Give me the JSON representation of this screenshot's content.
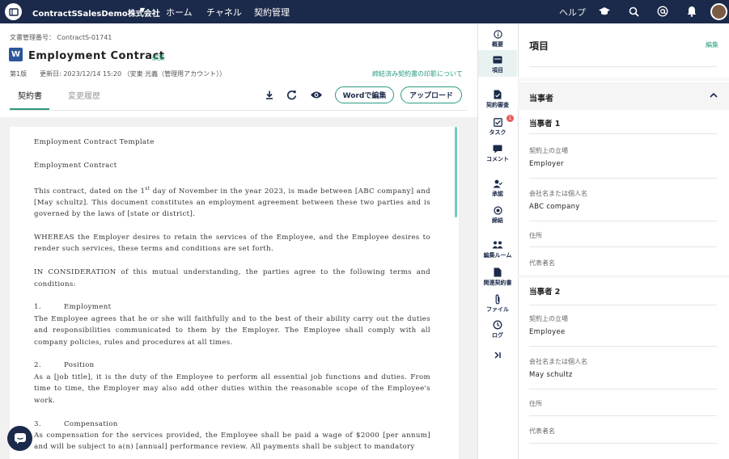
{
  "topbar": {
    "company": "ContractSSalesDemo株式会社",
    "nav": [
      "ホーム",
      "チャネル",
      "契約管理"
    ],
    "help": "ヘルプ",
    "icons": [
      "graduation-cap-icon",
      "search-icon",
      "at-icon",
      "bell-icon"
    ]
  },
  "document": {
    "number_label": "文書管理番号： ContractS-01741",
    "title": "Employment Contract",
    "edit_label": "編集",
    "version_line": "第1版　　更新日: 2023/12/14 15:20 （安東 光義（管理用アカウント））",
    "print_link": "締結済み契約書の印影について"
  },
  "tabs": [
    "契約書",
    "変更履歴"
  ],
  "actions": {
    "edit_in_word": "Wordで編集",
    "upload": "アップロード"
  },
  "contract": {
    "p1": "Employment Contract Template",
    "p2": "Employment Contract",
    "p3_pre": "This contract, dated on the 1",
    "p3_sup": "st",
    "p3_post": " day of November in the year 2023, is made between [ABC company] and [May schultz]. This document constitutes an employment agreement between these two parties and is governed by the laws of [state or district].",
    "p4": "WHEREAS the Employer desires to retain the services of the Employee, and the Employee desires to render such services, these terms and conditions are set forth.",
    "p5": "IN CONSIDERATION of this mutual understanding, the parties agree to the following terms and conditions:",
    "s1_num": "1.",
    "s1_head": "Employment",
    "s1_body": "The Employee agrees that he or she will faithfully and to the best of their ability carry out the duties and responsibilities communicated to them by the Employer. The Employee shall comply with all company policies, rules and procedures at all times.",
    "s2_num": "2.",
    "s2_head": "Position",
    "s2_body": "As a [job title], it is the duty of the Employee to perform all essential job functions and duties. From time to time, the Employer may also add other duties within the reasonable scope of the Employee's work.",
    "s3_num": "3.",
    "s3_head": "Compensation",
    "s3_body": "As compensation for the services provided, the Employee shall be paid a wage of $2000 [per annum] and will be subject to a(n) [annual] performance review. All payments shall be subject to mandatory"
  },
  "rail": {
    "items": [
      {
        "label": "概要",
        "icon": "info-icon"
      },
      {
        "label": "項目",
        "icon": "items-icon"
      },
      {
        "label": "契約審査",
        "icon": "review-icon"
      },
      {
        "label": "タスク",
        "icon": "task-icon"
      },
      {
        "label": "コメント",
        "icon": "comment-icon"
      },
      {
        "label": "承認",
        "icon": "approval-icon"
      },
      {
        "label": "締結",
        "icon": "seal-icon"
      },
      {
        "label": "編集ルーム",
        "icon": "people-icon"
      },
      {
        "label": "関連契約書",
        "icon": "related-doc-icon"
      },
      {
        "label": "ファイル",
        "icon": "paperclip-icon"
      },
      {
        "label": "ログ",
        "icon": "history-icon"
      }
    ],
    "task_badge": "1",
    "collapse_icon": "collapse-icon"
  },
  "panel": {
    "title": "項目",
    "edit": "編集",
    "section": "当事者",
    "party1": {
      "heading": "当事者 1",
      "role_label": "契約上の立場",
      "role_value": "Employer",
      "name_label": "会社名または個人名",
      "name_value": "ABC company",
      "address_label": "住所",
      "rep_label": "代表者名"
    },
    "party2": {
      "heading": "当事者 2",
      "role_label": "契約上の立場",
      "role_value": "Employee",
      "name_label": "会社名または個人名",
      "name_value": "May schultz",
      "address_label": "住所",
      "rep_label": "代表者名"
    }
  },
  "colors": {
    "navy": "#1b2a4a",
    "accent": "#2a9a80",
    "badge": "#e85a5a"
  }
}
